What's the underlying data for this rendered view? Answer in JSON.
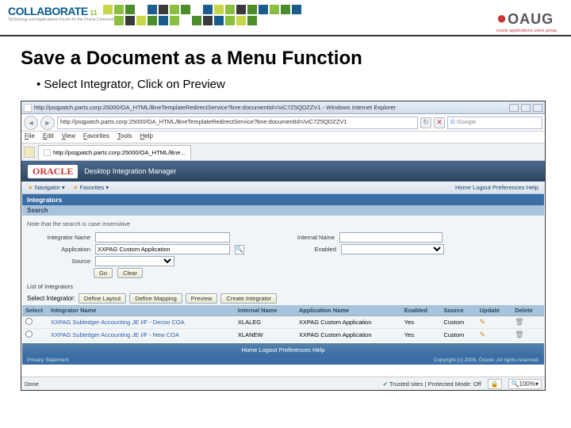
{
  "slide": {
    "title": "Save a Document as a Menu Function",
    "bullet": "Select Integrator, Click on Preview"
  },
  "oaug": {
    "brand": "OAUG",
    "tagline": "oracle applications users group"
  },
  "ie": {
    "title_prefix": "http://psqpatch.parts.corp:25000/OA_HTML/BneTemplateRedirectService?bne:documentId=/viC7Z5QDZZV1 - Windows Internet Explorer",
    "url": "http://psqpatch.parts.corp:25000/OA_HTML/BneTemplateRedirectService?bne:documentId=/viC7Z5QDZZV1",
    "search_hint": "Google",
    "menu": [
      "File",
      "Edit",
      "View",
      "Favorites",
      "Tools",
      "Help"
    ],
    "tab": "http://psqpatch.parts.corp:25000/OA_HTML/Bne...",
    "status_done": "Done",
    "status_trusted": "Trusted sites | Protected Mode: Off",
    "zoom": "100%"
  },
  "app": {
    "product": "ORACLE",
    "subtitle": "Desktop Integration Manager",
    "nav": {
      "navigator": "Navigator ▾",
      "favorites": "Favorites ▾",
      "links": "Home  Logout  Preferences  Help"
    },
    "integrators_hdr": "Integrators",
    "search_hdr": "Search",
    "note": "Note that the search is case insensitive",
    "fields": {
      "int_lbl": "Integrator Name",
      "int_val": "",
      "internal_lbl": "Internal Name",
      "internal_val": "",
      "app_lbl": "Application",
      "app_val": "XXPAG Custom Application",
      "enabled_lbl": "Enabled",
      "enabled_val": "",
      "source_lbl": "Source",
      "source_val": ""
    },
    "buttons": {
      "go": "Go",
      "clear": "Clear"
    },
    "list_hdr": "List of Integrators",
    "row_actions": {
      "select_lbl": "Select Integrator:",
      "define_layout": "Define Layout",
      "define_mapping": "Define Mapping",
      "preview": "Preview",
      "create": "Create Integrator"
    },
    "table": {
      "cols": [
        "Select",
        "Integrator Name",
        "Internal Name",
        "Application Name",
        "Enabled",
        "Source",
        "Update",
        "Delete"
      ],
      "rows": [
        {
          "name": "XXPAG Subledger Accounting JE I/F - Decoo COA",
          "internal": "XLALEG",
          "app": "XXPAG Custom Application",
          "enabled": "Yes",
          "source": "Custom"
        },
        {
          "name": "XXPAG Subledger Accounting JE I/F - New COA",
          "internal": "XLANEW",
          "app": "XXPAG Custom Application",
          "enabled": "Yes",
          "source": "Custom"
        }
      ]
    },
    "footer_links": "Home  Logout  Preferences  Help",
    "privacy": "Privacy Statement",
    "copyright": "Copyright (c) 2006, Oracle. All rights reserved."
  }
}
